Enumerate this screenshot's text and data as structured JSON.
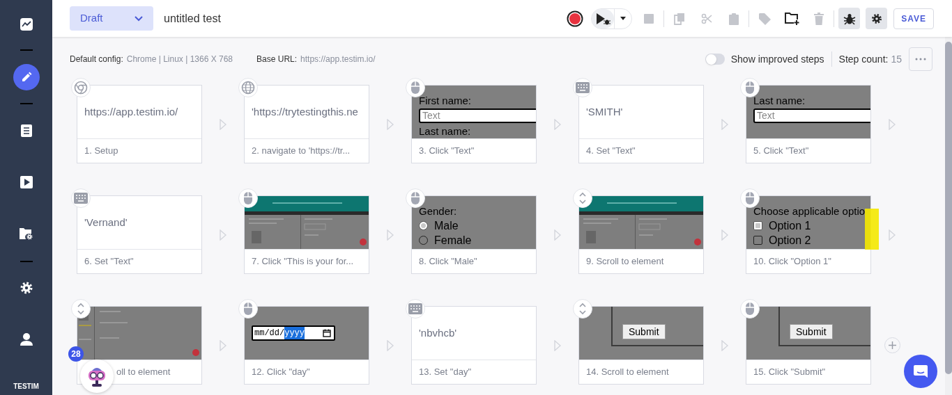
{
  "sidebar": {
    "groups": [
      [
        {
          "kind": "chart",
          "selected": false
        }
      ],
      [
        {
          "kind": "edit",
          "selected": true
        }
      ],
      [
        {
          "kind": "list",
          "selected": false
        },
        {
          "kind": "play",
          "selected": false
        },
        {
          "kind": "folder-settings",
          "selected": false
        }
      ],
      [
        {
          "kind": "settings",
          "selected": false
        },
        {
          "kind": "user",
          "selected": false
        }
      ]
    ],
    "logo": "TESTIM"
  },
  "header": {
    "status": "Draft",
    "title": "untitled test"
  },
  "toolbar": [
    [
      {
        "kind": "record"
      },
      {
        "kind": "run"
      },
      {
        "kind": "stop",
        "disabled": true
      }
    ],
    [
      {
        "kind": "copy",
        "disabled": true
      },
      {
        "kind": "cut",
        "disabled": true
      },
      {
        "kind": "paste",
        "disabled": true
      }
    ],
    [
      {
        "kind": "tag",
        "disabled": true
      },
      {
        "kind": "add-folder",
        "disabled": false
      },
      {
        "kind": "delete",
        "disabled": true
      }
    ],
    [
      {
        "kind": "debug",
        "active": true
      },
      {
        "kind": "settings",
        "active": true
      },
      {
        "kind": "save",
        "label": "SAVE"
      }
    ]
  ],
  "info": {
    "config_label": "Default config:",
    "config_value": "Chrome | Linux | 1366 X 768",
    "url_label": "Base URL:",
    "url_value": "https://app.testim.io/",
    "toggle": {
      "label": "Show improved steps",
      "on": false
    },
    "count_label": "Step count:",
    "count_value": "15"
  },
  "steps": [
    {
      "kind": "setup",
      "preview": {
        "kind": "text",
        "text": "https://app.testim.io/"
      },
      "caption": "1. Setup"
    },
    {
      "kind": "navigate",
      "preview": {
        "kind": "text",
        "text": "'https://trytestingthis.ne"
      },
      "caption": "2. navigate to 'https://tr..."
    },
    {
      "kind": "click",
      "preview": {
        "kind": "screenshot",
        "lines": [
          {
            "kind": "label",
            "text": "First name:"
          },
          {
            "kind": "input",
            "placeholder": "Text",
            "focused": true
          },
          {
            "kind": "label",
            "text": "Last name:"
          }
        ]
      },
      "caption": "3. Click \"Text\""
    },
    {
      "kind": "set",
      "preview": {
        "kind": "text",
        "text": "'SMITH'"
      },
      "caption": "4. Set \"Text\""
    },
    {
      "kind": "click",
      "preview": {
        "kind": "screenshot",
        "lines": [
          {
            "kind": "label",
            "text": "Last name:"
          },
          {
            "kind": "input",
            "placeholder": "Text",
            "focused": true
          }
        ]
      },
      "caption": "5. Click \"Text\""
    },
    {
      "kind": "set",
      "preview": {
        "kind": "text",
        "text": "'Vernand'"
      },
      "caption": "6. Set \"Text\""
    },
    {
      "kind": "click",
      "caption": "7. Click \"This is your for..."
    },
    {
      "kind": "click",
      "preview": {
        "kind": "screenshot",
        "lines": [
          {
            "kind": "label",
            "text": "Gender:"
          },
          {
            "kind": "radio",
            "text": "Male",
            "highlighted": true
          },
          {
            "kind": "radio",
            "text": "Female",
            "highlighted": false
          }
        ]
      },
      "caption": "8. Click \"Male\""
    },
    {
      "kind": "scroll",
      "caption": "9. Scroll to element"
    },
    {
      "kind": "click",
      "preview": {
        "kind": "screenshot",
        "lines": [
          {
            "kind": "label",
            "text": "Choose applicable optio"
          },
          {
            "kind": "checkbox",
            "text": "Option 1",
            "highlighted": true
          },
          {
            "kind": "checkbox",
            "text": "Option 2",
            "highlighted": false
          }
        ]
      },
      "highlight": true,
      "caption": "10. Click \"Option 1\""
    },
    {
      "kind": "scroll",
      "caption": "oll to element",
      "caption_covered": true
    },
    {
      "kind": "click",
      "preview": {
        "kind": "screenshot",
        "lines": [
          {
            "kind": "date",
            "text": "mm/dd/",
            "selected_text": "yyyy"
          }
        ]
      },
      "caption": "12. Click \"day\""
    },
    {
      "kind": "set",
      "preview": {
        "kind": "text",
        "text": "'nbvhcb'"
      },
      "caption": "13. Set \"day\""
    },
    {
      "kind": "scroll",
      "preview": {
        "kind": "screenshot",
        "lines": [
          {
            "kind": "button",
            "text": "Submit"
          }
        ]
      },
      "caption": "14. Scroll to element"
    },
    {
      "kind": "click",
      "preview": {
        "kind": "screenshot",
        "lines": [
          {
            "kind": "button",
            "text": "Submit"
          }
        ]
      },
      "caption": "15. Click \"Submit\""
    }
  ],
  "assistant": {
    "badge": "28"
  }
}
